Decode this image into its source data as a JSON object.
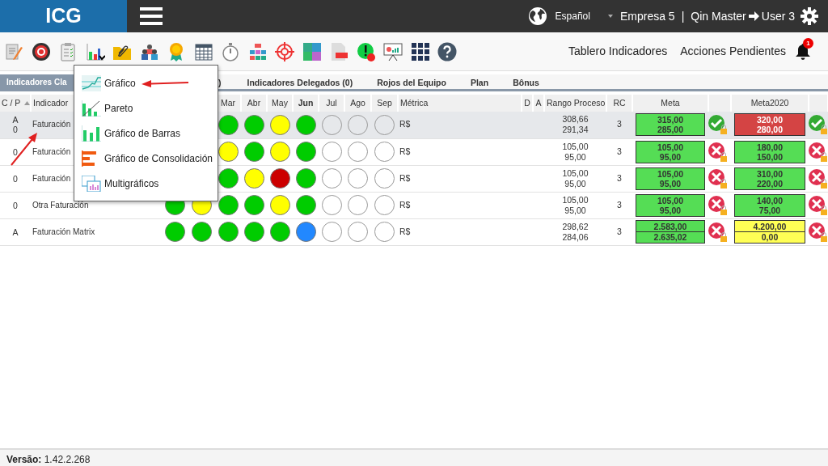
{
  "topbar": {
    "logo": "ICG",
    "language": "Español",
    "company": "Empresa 5",
    "separator": "|",
    "user_from": "Qin Master",
    "user_to": "User 3"
  },
  "toolbar": {
    "links": [
      "Tablero Indicadores",
      "Acciones Pendientes"
    ],
    "notifications": "1"
  },
  "tabs": [
    {
      "label": "Indicadores Cla",
      "selected": true
    },
    {
      "label": ")",
      "selected": false
    },
    {
      "label": "Indicadores Delegados (0)",
      "selected": false
    },
    {
      "label": "Rojos del Equipo",
      "selected": false
    },
    {
      "label": "Plan",
      "selected": false
    },
    {
      "label": "Bônus",
      "selected": false
    }
  ],
  "columns": [
    {
      "kind": "text",
      "label": "C / P"
    },
    {
      "kind": "text",
      "label": "Indicador"
    },
    {
      "kind": "blank"
    },
    {
      "kind": "blank"
    },
    {
      "kind": "month",
      "label": "Mar",
      "current": false
    },
    {
      "kind": "month",
      "label": "Abr",
      "current": false
    },
    {
      "kind": "month",
      "label": "May",
      "current": false
    },
    {
      "kind": "month",
      "label": "Jun",
      "current": true
    },
    {
      "kind": "month",
      "label": "Jul",
      "current": false
    },
    {
      "kind": "month",
      "label": "Ago",
      "current": false
    },
    {
      "kind": "month",
      "label": "Sep",
      "current": false
    },
    {
      "kind": "text",
      "label": "Métrica"
    },
    {
      "kind": "text",
      "label": "D"
    },
    {
      "kind": "text",
      "label": "A"
    },
    {
      "kind": "text",
      "label": "Rango Proceso"
    },
    {
      "kind": "text",
      "label": "RC"
    },
    {
      "kind": "text",
      "label": "Meta"
    },
    {
      "kind": "blank"
    },
    {
      "kind": "text",
      "label": "Meta2020"
    },
    {
      "kind": "blank"
    }
  ],
  "rows": [
    {
      "selected": true,
      "cp": [
        "A",
        "0"
      ],
      "name": "Faturación",
      "lights": [
        {
          "kind": "hidden"
        },
        {
          "kind": "hidden"
        },
        {
          "kind": "filled",
          "color": "#00cc00"
        },
        {
          "kind": "filled",
          "color": "#00cc00"
        },
        {
          "kind": "filled",
          "color": "#ffff00"
        },
        {
          "kind": "filled",
          "color": "#00cc00"
        },
        {
          "kind": "empty"
        },
        {
          "kind": "empty"
        },
        {
          "kind": "empty"
        }
      ],
      "metric": "R$",
      "range": [
        "308,66",
        "291,34"
      ],
      "rc": "3",
      "meta": {
        "values": [
          "315,00",
          "285,00"
        ],
        "color": "#55dd55"
      },
      "meta_ok": true,
      "meta2020": {
        "values": [
          "320,00",
          "280,00"
        ],
        "color": "#d44444"
      },
      "meta2020_ok": true
    },
    {
      "selected": false,
      "cp": [
        "0"
      ],
      "name": "Faturación",
      "lights": [
        {
          "kind": "hidden"
        },
        {
          "kind": "hidden"
        },
        {
          "kind": "filled",
          "color": "#ffff00"
        },
        {
          "kind": "filled",
          "color": "#00cc00"
        },
        {
          "kind": "filled",
          "color": "#ffff00"
        },
        {
          "kind": "filled",
          "color": "#00cc00"
        },
        {
          "kind": "empty"
        },
        {
          "kind": "empty"
        },
        {
          "kind": "empty"
        }
      ],
      "metric": "R$",
      "range": [
        "105,00",
        "95,00"
      ],
      "rc": "3",
      "meta": {
        "values": [
          "105,00",
          "95,00"
        ],
        "color": "#55dd55"
      },
      "meta_ok": false,
      "meta2020": {
        "values": [
          "180,00",
          "150,00"
        ],
        "color": "#55dd55"
      },
      "meta2020_ok": false
    },
    {
      "selected": false,
      "cp": [
        "0"
      ],
      "name": "Faturación",
      "lights": [
        {
          "kind": "hidden"
        },
        {
          "kind": "hidden"
        },
        {
          "kind": "filled",
          "color": "#00cc00"
        },
        {
          "kind": "filled",
          "color": "#ffff00"
        },
        {
          "kind": "filled",
          "color": "#cc0000"
        },
        {
          "kind": "filled",
          "color": "#00cc00"
        },
        {
          "kind": "empty"
        },
        {
          "kind": "empty"
        },
        {
          "kind": "empty"
        }
      ],
      "metric": "R$",
      "range": [
        "105,00",
        "95,00"
      ],
      "rc": "3",
      "meta": {
        "values": [
          "105,00",
          "95,00"
        ],
        "color": "#55dd55"
      },
      "meta_ok": false,
      "meta2020": {
        "values": [
          "310,00",
          "220,00"
        ],
        "color": "#55dd55"
      },
      "meta2020_ok": false
    },
    {
      "selected": false,
      "cp": [
        "0"
      ],
      "name": "Otra Faturación",
      "lights": [
        {
          "kind": "filled",
          "color": "#00cc00"
        },
        {
          "kind": "filled",
          "color": "#ffff00"
        },
        {
          "kind": "filled",
          "color": "#00cc00"
        },
        {
          "kind": "filled",
          "color": "#00cc00"
        },
        {
          "kind": "filled",
          "color": "#ffff00"
        },
        {
          "kind": "filled",
          "color": "#00cc00"
        },
        {
          "kind": "empty"
        },
        {
          "kind": "empty"
        },
        {
          "kind": "empty"
        }
      ],
      "metric": "R$",
      "range": [
        "105,00",
        "95,00"
      ],
      "rc": "3",
      "meta": {
        "values": [
          "105,00",
          "95,00"
        ],
        "color": "#55dd55"
      },
      "meta_ok": false,
      "meta2020": {
        "values": [
          "140,00",
          "75,00"
        ],
        "color": "#55dd55"
      },
      "meta2020_ok": false
    },
    {
      "selected": false,
      "cp": [
        "A"
      ],
      "name": "Faturación Matrix",
      "lights": [
        {
          "kind": "filled",
          "color": "#00cc00"
        },
        {
          "kind": "filled",
          "color": "#00cc00"
        },
        {
          "kind": "filled",
          "color": "#00cc00"
        },
        {
          "kind": "filled",
          "color": "#00cc00"
        },
        {
          "kind": "filled",
          "color": "#00cc00"
        },
        {
          "kind": "filled",
          "color": "#2288ff"
        },
        {
          "kind": "empty"
        },
        {
          "kind": "empty"
        },
        {
          "kind": "empty"
        }
      ],
      "metric": "R$",
      "range": [
        "298,62",
        "284,06"
      ],
      "rc": "3",
      "meta": {
        "values": [
          "2.583,00",
          "2.635,02"
        ],
        "color": "#55dd55"
      },
      "meta_ok": false,
      "meta2020": {
        "values": [
          "4.200,00",
          "0,00"
        ],
        "color": "#ffff55"
      },
      "meta2020_ok": false
    }
  ],
  "chart_menu": [
    {
      "kind": "line",
      "label": "Gráfico"
    },
    {
      "kind": "pareto",
      "label": "Pareto"
    },
    {
      "kind": "bars",
      "label": "Gráfico de Barras"
    },
    {
      "kind": "consolidation",
      "label": "Gráfico de Consolidación"
    },
    {
      "kind": "multi",
      "label": "Multigráficos"
    }
  ],
  "footer": "**Versão:** 1.42.2.268"
}
